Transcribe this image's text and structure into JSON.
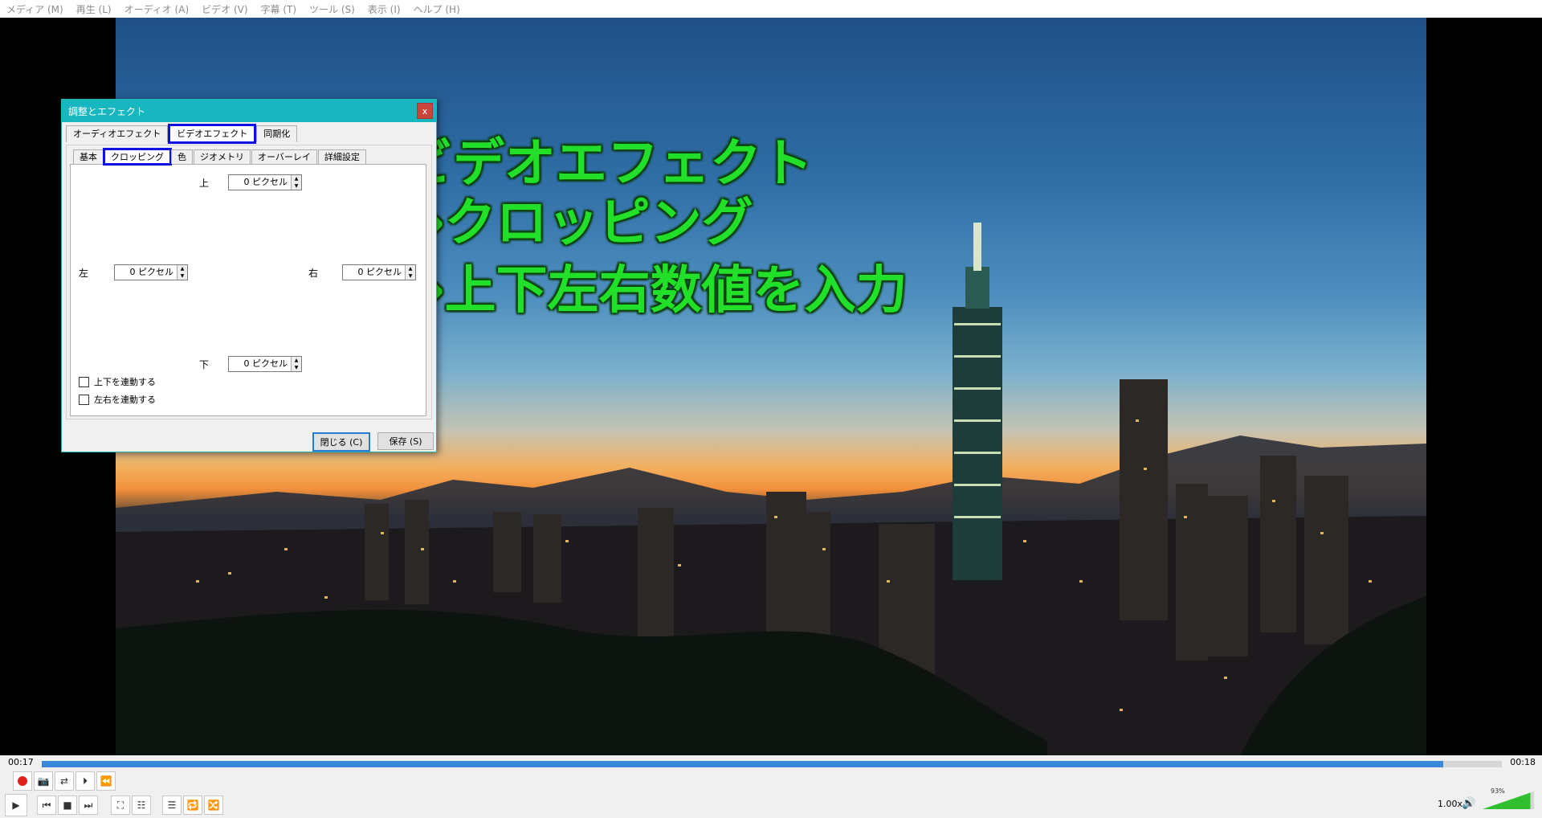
{
  "menu": [
    "メディア (M)",
    "再生 (L)",
    "オーディオ (A)",
    "ビデオ (V)",
    "字幕 (T)",
    "ツール (S)",
    "表示 (I)",
    "ヘルプ (H)"
  ],
  "annotation": {
    "line1": "ビデオエフェクト",
    "line2": "→クロッピング",
    "line3": "→上下左右数値を入力"
  },
  "dialog": {
    "title": "調整とエフェクト",
    "close": "x",
    "tabs": [
      "オーディオエフェクト",
      "ビデオエフェクト",
      "同期化"
    ],
    "active_tab": "ビデオエフェクト",
    "subtabs": [
      "基本",
      "クロッピング",
      "色",
      "ジオメトリ",
      "オーバーレイ",
      "詳細設定"
    ],
    "active_subtab": "クロッピング",
    "labels": {
      "top": "上",
      "left": "左",
      "right": "右",
      "bottom": "下"
    },
    "values": {
      "top": "0 ピクセル",
      "left": "0 ピクセル",
      "right": "0 ピクセル",
      "bottom": "0 ピクセル"
    },
    "checkboxes": [
      "上下を連動する",
      "左右を連動する"
    ],
    "buttons": {
      "close": "閉じる (C)",
      "save": "保存 (S)"
    }
  },
  "player": {
    "time_current": "00:17",
    "time_total": "00:18",
    "progress": 0.96,
    "rate": "1.00x",
    "volume_label": "93%",
    "volume": 0.93
  },
  "colors": {
    "annotation": "#22e02a",
    "highlight": "#1010e8",
    "seek": "#3a86d8",
    "titlebar": "#18b7bf"
  }
}
